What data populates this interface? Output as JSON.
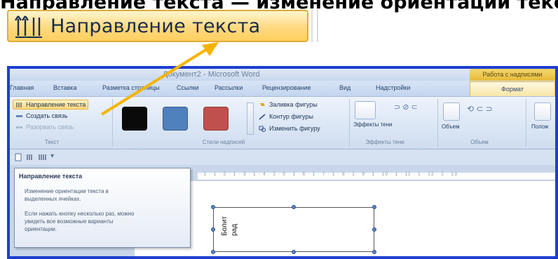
{
  "heading": "Направление текста — изменение ориентации текста в выделенных ячейках",
  "zoomed_button": {
    "label": "Направление текста",
    "icon": "text-direction-icon"
  },
  "window": {
    "title": "Документ2 - Microsoft Word",
    "context_tab": "Работа с надписями"
  },
  "tabs": [
    "Главная",
    "Вставка",
    "Разметка страницы",
    "Ссылки",
    "Рассылки",
    "Рецензирование",
    "Вид",
    "Надстройки",
    "Формат"
  ],
  "ribbon": {
    "text_group": {
      "items": [
        "Направление текста",
        "Создать связь",
        "Разорвать связь"
      ],
      "label": "Текст"
    },
    "styles_group": {
      "swatch_colors": [
        "#0a0a0a",
        "#4f81bd",
        "#c0504d"
      ],
      "commands": [
        "Заливка фигуры",
        "Контур фигуры",
        "Изменить фигуру"
      ],
      "label": "Стили надписей"
    },
    "shadow_group": {
      "button": "Эффекты тени",
      "label": "Эффекты тени"
    },
    "volume_group": {
      "button": "Объем",
      "label": "Объем"
    },
    "position_label": "Полож"
  },
  "tooltip": {
    "title": "Направление текста",
    "lines": [
      "Изменение ориентации текста в",
      "выделенных ячейках.",
      "Если нажать кнопку несколько раз, можно",
      "увидеть все возможные варианты",
      "ориентации."
    ]
  },
  "ruler_text": "· 1 · 1 · 2 · 1 · 3 · 1 · 4 · 1 · 5 · 1 · 6 · 1 · 7 · 1 · 8 · 1 · 9 · 1 · 10 · 1 · 11 · 1 · 12 · 1 · 13",
  "textbox": {
    "lines": [
      "Болит",
      "рад"
    ]
  },
  "colors": {
    "frame": "#1e3ed0",
    "arrow": "#f5b400",
    "highlight": "#ffd87a"
  }
}
